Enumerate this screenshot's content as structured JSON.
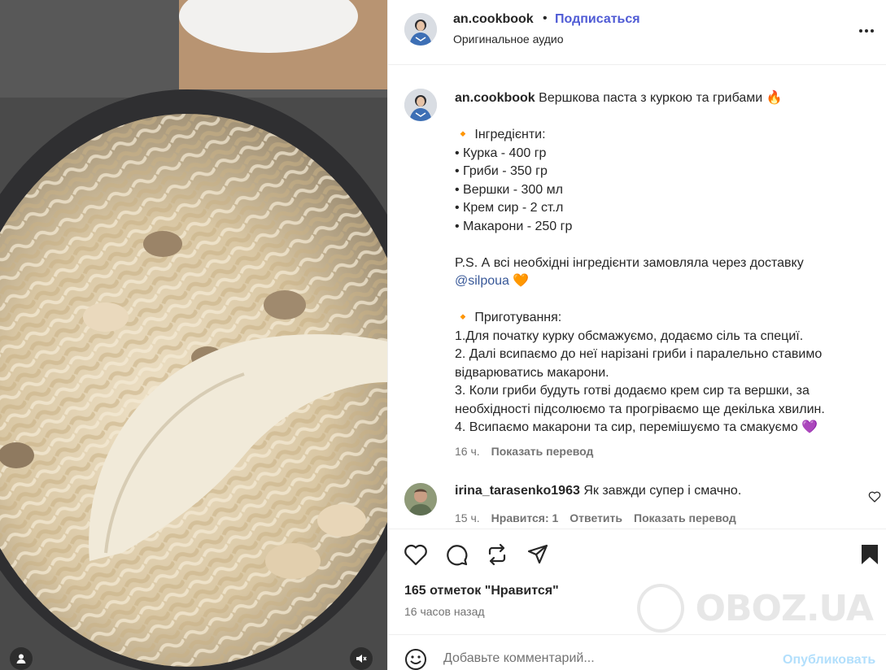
{
  "header": {
    "username": "an.cookbook",
    "separator": "•",
    "follow_label": "Подписаться",
    "audio_label": "Оригинальное аудио",
    "more_icon": "more-horizontal-icon"
  },
  "caption": {
    "username": "an.cookbook",
    "title": "Вершкова паста з куркою та грибами 🔥",
    "ingredients_heading": "🔸 Інгредієнти:",
    "ingredients": [
      "• Курка - 400 гр",
      "• Гриби - 350 гр",
      "• Вершки - 300 мл",
      "• Крем сир - 2 ст.л",
      "• Макарони - 250 гр"
    ],
    "ps_text": "P.S. А всі необхідні інгредієнти замовляла через доставку",
    "mention": "@silpoua",
    "mention_emoji": "🧡",
    "steps_heading": "🔸 Приготування:",
    "steps": [
      "1.Для початку курку обсмажуємо, додаємо сіль та специї.",
      "2. Далі всипаємо до неї нарізані гриби і паралельно ставимо",
      "відварюватись макарони.",
      "3. Коли гриби будуть готві додаємо крем сир та вершки, за",
      "необхідності підсолюємо та прогріваємо ще декілька хвилин.",
      "4. Всипаємо макарони та сир, перемішуємо та смакуємо 💜"
    ],
    "age": "16 ч.",
    "translate_label": "Показать перевод"
  },
  "comment": {
    "username": "irina_tarasenko1963",
    "text": "Як завжди супер і смачно.",
    "age": "15 ч.",
    "likes_label": "Нравится: 1",
    "reply_label": "Ответить",
    "translate_label": "Показать перевод"
  },
  "actions": {
    "like_icon": "heart-icon",
    "comment_icon": "comment-icon",
    "repost_icon": "repost-icon",
    "share_icon": "send-icon",
    "save_icon": "bookmark-icon"
  },
  "stats": {
    "likes": "165 отметок \"Нравится\"",
    "posted": "16 часов назад"
  },
  "add_comment": {
    "placeholder": "Добавьте комментарий...",
    "publish_label": "Опубликовать"
  },
  "watermark": {
    "text": "OBOZ.UA"
  },
  "colors": {
    "follow": "#4f5bd5",
    "publish_disabled": "#b2dffc",
    "secondary_text": "#737373",
    "border": "#efefef"
  }
}
